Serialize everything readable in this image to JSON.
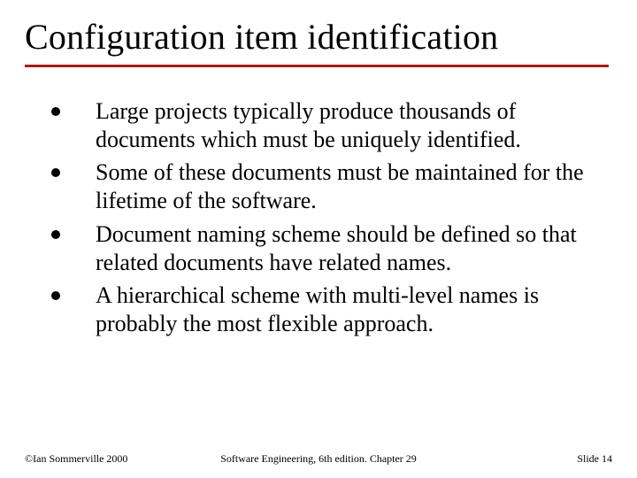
{
  "title": "Configuration item identification",
  "bullets": [
    "Large projects typically produce thousands of documents which must be uniquely identified.",
    "Some of these documents must be maintained for the lifetime of the software.",
    "Document naming scheme should be defined so that related documents have related names.",
    "A hierarchical scheme with multi-level names is probably the most flexible approach."
  ],
  "footer": {
    "left": "©Ian Sommerville 2000",
    "center": "Software Engineering, 6th edition. Chapter 29",
    "right": "Slide 14"
  }
}
